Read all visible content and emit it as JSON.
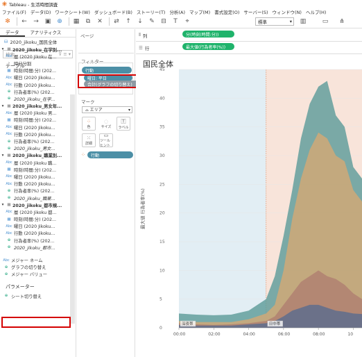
{
  "window": {
    "title": "Tableau - 生活時間調査"
  },
  "menu": [
    "ファイル(F)",
    "データ(D)",
    "ワークシート(W)",
    "ダッシュボード(B)",
    "ストーリー(T)",
    "分析(A)",
    "マップ(M)",
    "書式設定(O)",
    "サーバー(S)",
    "ウィンドウ(N)",
    "ヘルプ(H)"
  ],
  "toolbar": {
    "fit_select": "標準"
  },
  "left_panel": {
    "tabs": [
      "データ",
      "アナリティクス"
    ],
    "datasource": "2020_jikoku_国民全体",
    "search_placeholder": "検索",
    "table_header": "テーブル",
    "groups": [
      {
        "name": "2020_jikoku_在学別...",
        "fields": [
          {
            "type": "abc",
            "name": "層 (2020 Jikoku 在..."
          },
          {
            "type": "time",
            "name": "時分分割"
          },
          {
            "type": "cal",
            "name": "時刻(時間:分) (202..."
          },
          {
            "type": "abc",
            "name": "曜日 (2020 Jikoku..."
          },
          {
            "type": "abc",
            "name": "行動 (2020 Jikoku..."
          },
          {
            "type": "meas",
            "name": "行為者率(%) (202..."
          },
          {
            "type": "meas",
            "name": "2020_jikoku_在学..."
          }
        ]
      },
      {
        "name": "2020_jikoku_男女年...",
        "fields": [
          {
            "type": "abc",
            "name": "層 (2020 Jikoku 男..."
          },
          {
            "type": "cal",
            "name": "時刻(時間:分) (202..."
          },
          {
            "type": "abc",
            "name": "曜日 (2020 Jikoku..."
          },
          {
            "type": "abc",
            "name": "行動 (2020 Jikoku..."
          },
          {
            "type": "meas",
            "name": "行為者率(%) (202..."
          },
          {
            "type": "meas",
            "name": "2020_jikoku_男女..."
          }
        ]
      },
      {
        "name": "2020_jikoku_職業別...",
        "fields": [
          {
            "type": "abc",
            "name": "層 (2020 Jikoku 職..."
          },
          {
            "type": "cal",
            "name": "時刻(時間:分) (202..."
          },
          {
            "type": "abc",
            "name": "曜日 (2020 Jikoku..."
          },
          {
            "type": "abc",
            "name": "行動 (2020 Jikoku..."
          },
          {
            "type": "meas",
            "name": "行為者率(%) (202..."
          },
          {
            "type": "meas",
            "name": "2020_jikoku_職業..."
          }
        ]
      },
      {
        "name": "2020_jikoku_都市規...",
        "fields": [
          {
            "type": "abc",
            "name": "層 (2020 Jikoku 都..."
          },
          {
            "type": "cal",
            "name": "時刻(時間:分) (202..."
          },
          {
            "type": "abc",
            "name": "曜日 (2020 Jikoku..."
          },
          {
            "type": "abc",
            "name": "行動 (2020 Jikoku..."
          },
          {
            "type": "meas",
            "name": "行為者率(%) (202..."
          },
          {
            "type": "meas",
            "name": "2020_jikoku_都市..."
          }
        ]
      }
    ],
    "extra": [
      {
        "type": "abc",
        "name": "メジャー ネーム"
      },
      {
        "type": "meas",
        "name": "グラフの切り替え"
      },
      {
        "type": "meas",
        "name": "メジャー バリュー"
      }
    ],
    "params_header": "パラメーター",
    "params": [
      {
        "type": "meas",
        "name": "シート切り替え"
      }
    ]
  },
  "mid_panel": {
    "pages_title": "ページ",
    "filters_title": "フィルター",
    "filter_pills": [
      "行動",
      "曜日: 平日",
      "合計(グラフの切り替え)"
    ],
    "marks_title": "マーク",
    "mark_type": "エリア",
    "mark_buttons": [
      "色",
      "サイズ",
      "ラベル",
      "詳細",
      "ツールヒント"
    ],
    "mark_pill": "行動"
  },
  "shelves": {
    "columns_label": "列",
    "rows_label": "行",
    "columns_pill": "分(時刻(時間:分))",
    "rows_pill": "最大値(行為者率(%))"
  },
  "sheet_title": "国民全体",
  "colors": {
    "accent_blue": "#4c8fa6",
    "pill_green": "#1fb36b",
    "highlight_red": "#d40000"
  },
  "chart_data": {
    "type": "area",
    "ylabel": "最大値 行為者率(%)",
    "x_ticks": [
      "00:00",
      "02:00",
      "04:00",
      "06:00",
      "08:00",
      "10"
    ],
    "y_ticks": [
      45,
      40,
      35,
      30,
      25,
      20,
      15,
      10,
      5,
      0
    ],
    "ylim": [
      0,
      45
    ],
    "x_hours": [
      0,
      1,
      2,
      3,
      4,
      5,
      5.5,
      6,
      6.5,
      7,
      7.5,
      8,
      8.5,
      9,
      9.5,
      10,
      10.5
    ],
    "bands": [
      {
        "label": "深夜帯",
        "from": 0,
        "to": 5,
        "color": "#e2eef4"
      },
      {
        "label": "日中帯",
        "from": 5,
        "to": 10.5,
        "color": "#f8e4da"
      }
    ],
    "series": [
      {
        "color": "#5e9c9a",
        "values": [
          2.5,
          2.3,
          2.2,
          2.3,
          3,
          5,
          9,
          16,
          24,
          33,
          39,
          42,
          43,
          37,
          35,
          28,
          26
        ]
      },
      {
        "color": "#d3a875",
        "values": [
          1.2,
          1,
          1,
          1,
          1.5,
          2.5,
          4,
          10,
          19,
          26,
          31,
          34,
          33,
          30,
          29,
          24,
          22
        ]
      },
      {
        "color": "#b07f70",
        "values": [
          0.8,
          0.6,
          0.5,
          0.6,
          0.8,
          1.2,
          2,
          4,
          6,
          8,
          9,
          10,
          9,
          8.5,
          7.5,
          6,
          5
        ]
      },
      {
        "color": "#5c6c8e",
        "values": [
          0.5,
          0.4,
          0.4,
          0.4,
          0.6,
          0.8,
          1.2,
          2,
          3,
          3.5,
          4,
          4,
          3.5,
          3,
          2.8,
          2.5,
          2.4
        ]
      }
    ]
  }
}
